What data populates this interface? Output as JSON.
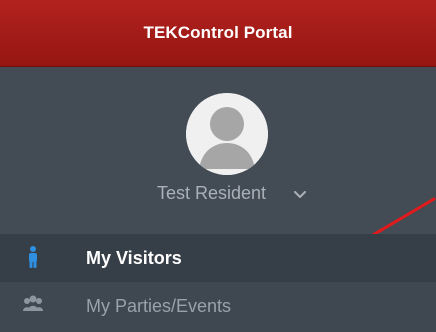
{
  "header": {
    "title": "TEKControl Portal"
  },
  "profile": {
    "name": "Test Resident",
    "avatar_icon": "user-silhouette-icon",
    "dropdown_icon": "chevron-down-icon"
  },
  "menu": {
    "items": [
      {
        "label": "My Visitors",
        "icon": "person-icon",
        "active": true
      },
      {
        "label": "My Parties/Events",
        "icon": "group-icon",
        "active": false
      }
    ]
  },
  "colors": {
    "header": "#a31d19",
    "sidebar": "#434b55",
    "active_item": "#363e47",
    "active_text": "#ffffff",
    "inactive_text": "#99a1aa",
    "profile_text": "#a9b0b8",
    "visitor_icon": "#2f8fe1",
    "annotation_arrow": "#e11b1b"
  }
}
